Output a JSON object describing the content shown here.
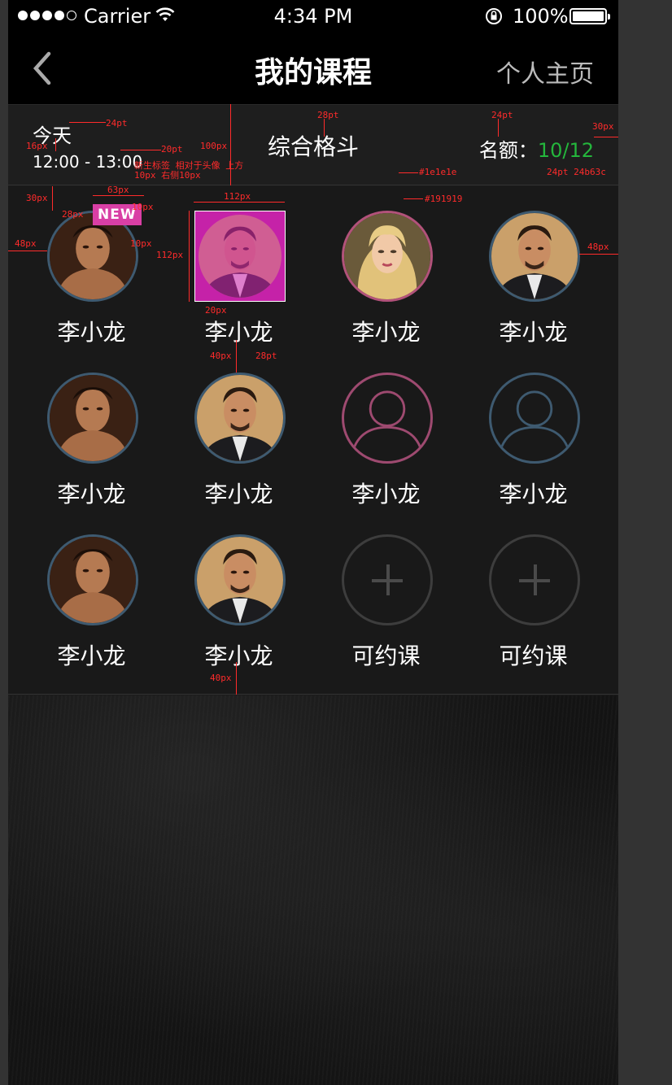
{
  "status_bar": {
    "carrier": "Carrier",
    "time": "4:34 PM",
    "battery": "100%",
    "icons": [
      "signal-dots-icon",
      "wifi-icon",
      "rotation-lock-icon",
      "battery-icon"
    ]
  },
  "nav": {
    "back_icon": "chevron-left-icon",
    "title": "我的课程",
    "home_link": "个人主页"
  },
  "info": {
    "today": "今天",
    "time_range": "12:00 - 13:00",
    "course_name": "综合格斗",
    "quota_label": "名额：",
    "quota_value": "10/12"
  },
  "grid": {
    "new_badge": "NEW",
    "cells": [
      {
        "name": "李小龙",
        "type": "photo",
        "photo": "fighter",
        "ring": "blue",
        "new": true
      },
      {
        "name": "李小龙",
        "type": "photo",
        "photo": "man-suit",
        "ring": "selected"
      },
      {
        "name": "李小龙",
        "type": "photo",
        "photo": "woman-blonde",
        "ring": "pink"
      },
      {
        "name": "李小龙",
        "type": "photo",
        "photo": "man-suit",
        "ring": "blue"
      },
      {
        "name": "李小龙",
        "type": "photo",
        "photo": "fighter",
        "ring": "blue"
      },
      {
        "name": "李小龙",
        "type": "photo",
        "photo": "man-suit",
        "ring": "blue"
      },
      {
        "name": "李小龙",
        "type": "placeholder",
        "ring": "pink"
      },
      {
        "name": "李小龙",
        "type": "placeholder",
        "ring": "blue"
      },
      {
        "name": "李小龙",
        "type": "photo",
        "photo": "fighter",
        "ring": "blue"
      },
      {
        "name": "李小龙",
        "type": "photo",
        "photo": "man-suit",
        "ring": "blue"
      },
      {
        "name": "可约课",
        "type": "add"
      },
      {
        "name": "可约课",
        "type": "add"
      }
    ]
  },
  "annotations": {
    "a1": "24pt",
    "a2": "16px",
    "a3": "20pt",
    "a4": "100px",
    "a5": "28pt",
    "a6": "24pt",
    "a7": "30px",
    "a8": "24pt 24b63c",
    "a9": "#1e1e1e",
    "a10": "#191919",
    "a11": "30px",
    "a12": "63px",
    "a13": "28px",
    "a14": "10px",
    "a15": "112px",
    "a16": "48px",
    "a17": "10px",
    "a18": "112px",
    "a19": "48px",
    "a20": "20px",
    "a21": "40px",
    "a22": "28pt",
    "a23": "40px",
    "a24": "新生标签 相对于头像 上方10px 右侧10px"
  },
  "colors": {
    "info_bg": "#1e1e1e",
    "grid_bg": "#191919",
    "quota_green": "#24b63c",
    "ring_blue": "#3e5a70",
    "ring_pink": "#b2527a",
    "badge_pink": "#d93fa5"
  }
}
